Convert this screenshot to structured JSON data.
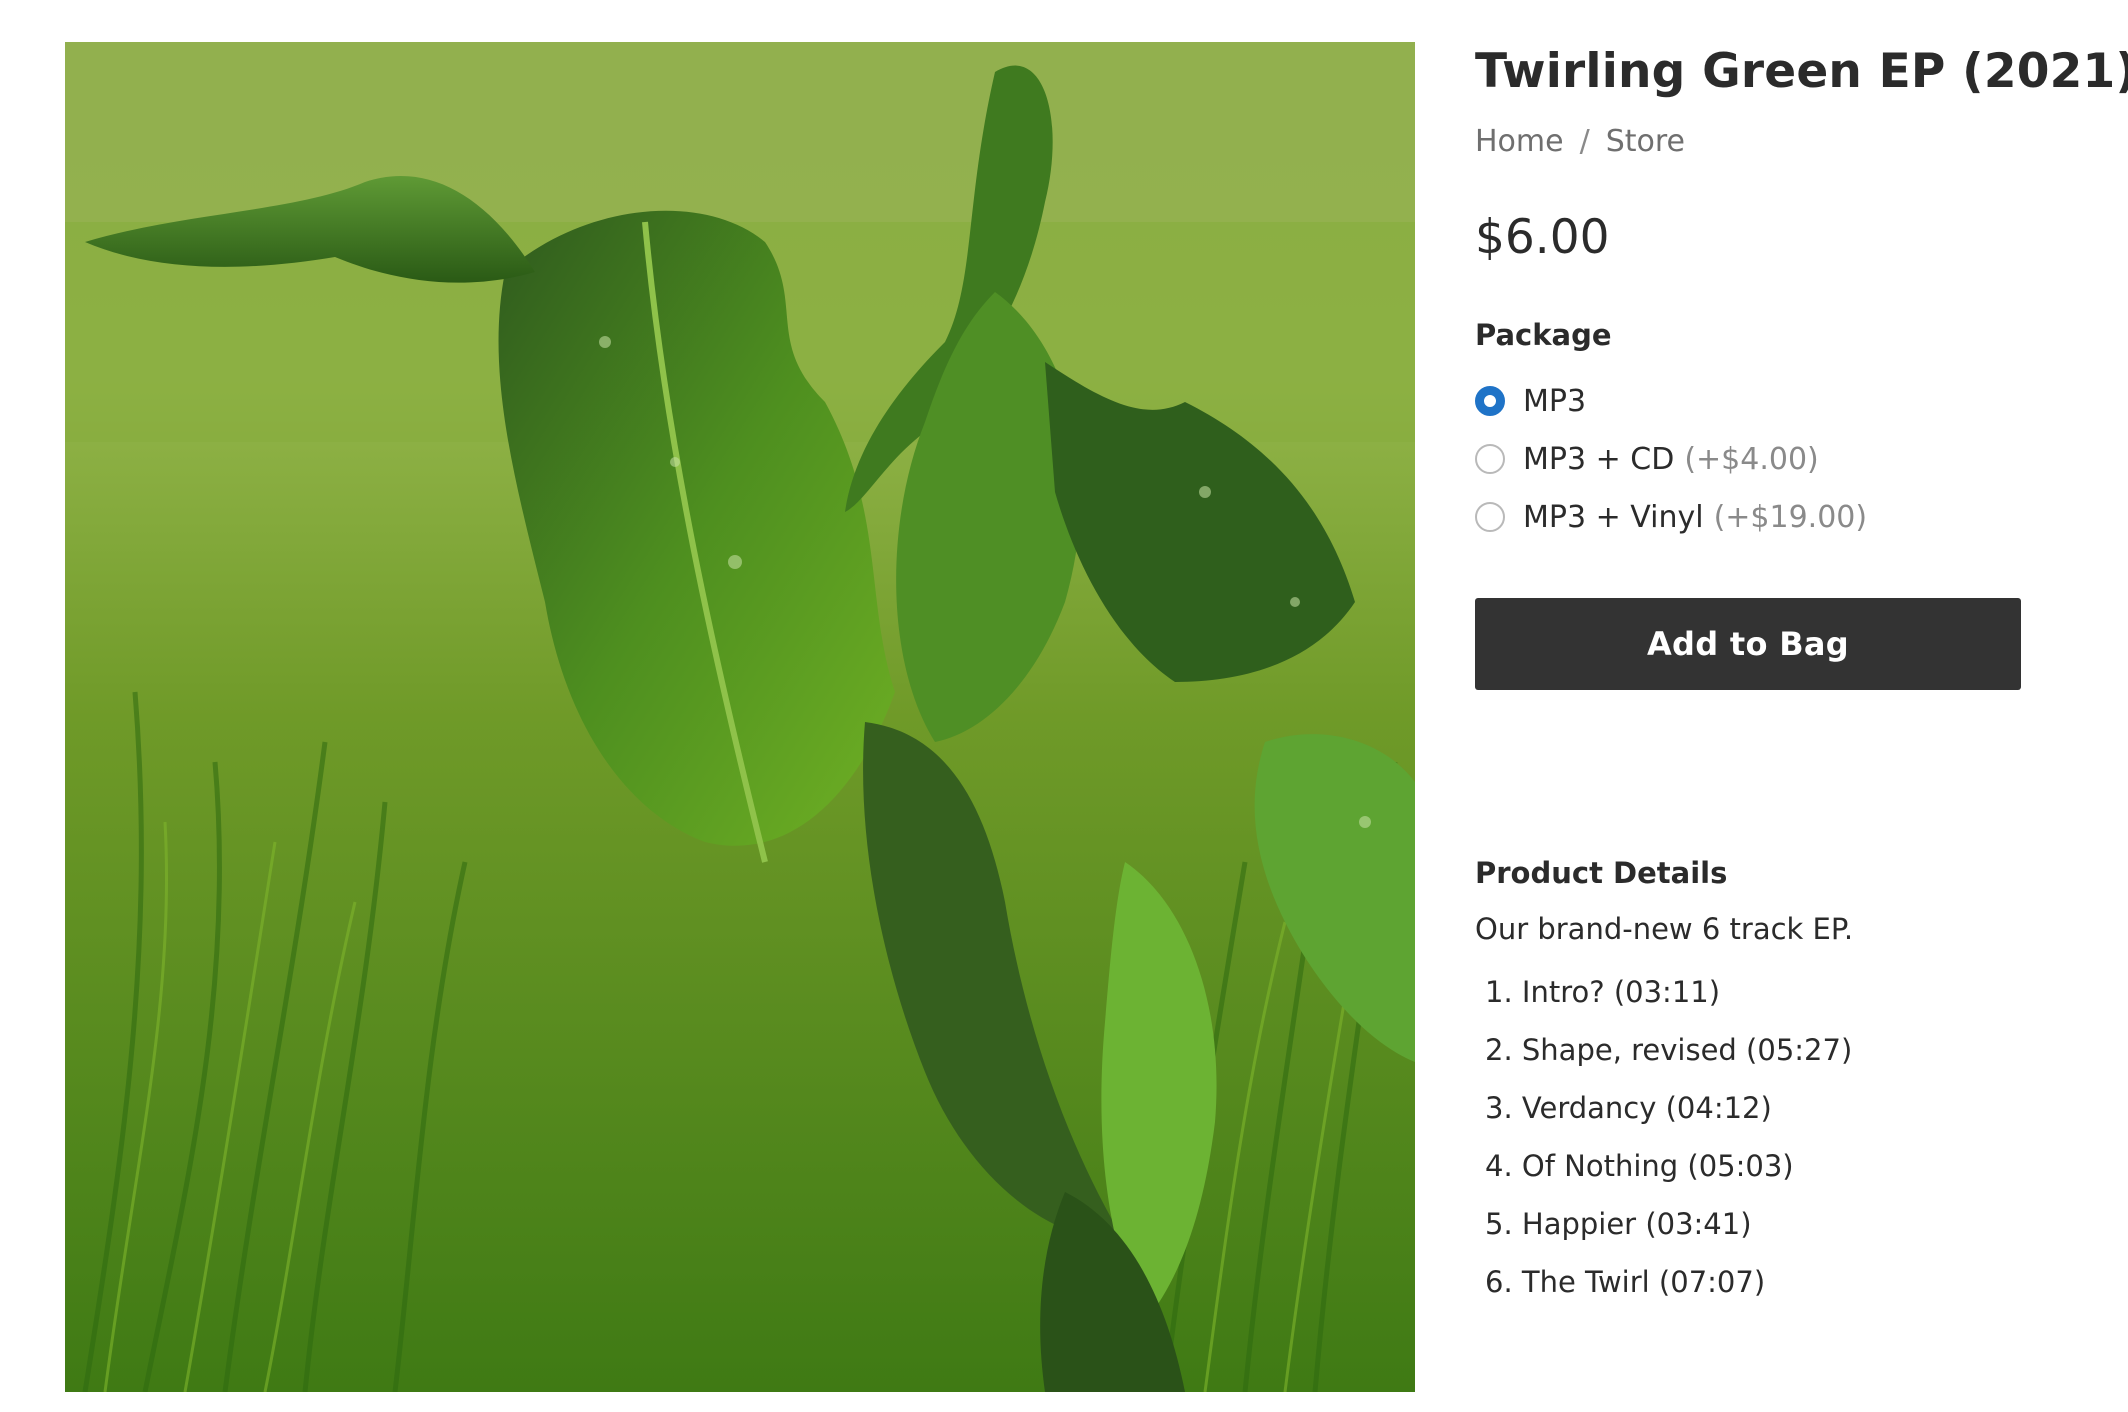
{
  "product": {
    "title": "Twirling Green EP (2021)",
    "price": "$6.00"
  },
  "breadcrumb": {
    "home": "Home",
    "separator": "/",
    "store": "Store"
  },
  "package": {
    "label": "Package",
    "options": [
      {
        "label": "MP3",
        "addon": "",
        "selected": true
      },
      {
        "label": "MP3 + CD",
        "addon": "(+$4.00)",
        "selected": false
      },
      {
        "label": "MP3 + Vinyl",
        "addon": "(+$19.00)",
        "selected": false
      }
    ]
  },
  "actions": {
    "add_to_bag": "Add to Bag"
  },
  "details": {
    "label": "Product Details",
    "description": "Our brand-new 6 track EP.",
    "tracks": [
      "1. Intro? (03:11)",
      "2. Shape, revised (05:27)",
      "3. Verdancy (04:12)",
      "4. Of Nothing (05:03)",
      "5. Happier (03:41)",
      "6. The Twirl (07:07)"
    ]
  },
  "colors": {
    "button_bg": "#333333",
    "radio_selected": "#1f73c7",
    "text": "#2b2b2b",
    "muted": "#6f6f6f"
  }
}
